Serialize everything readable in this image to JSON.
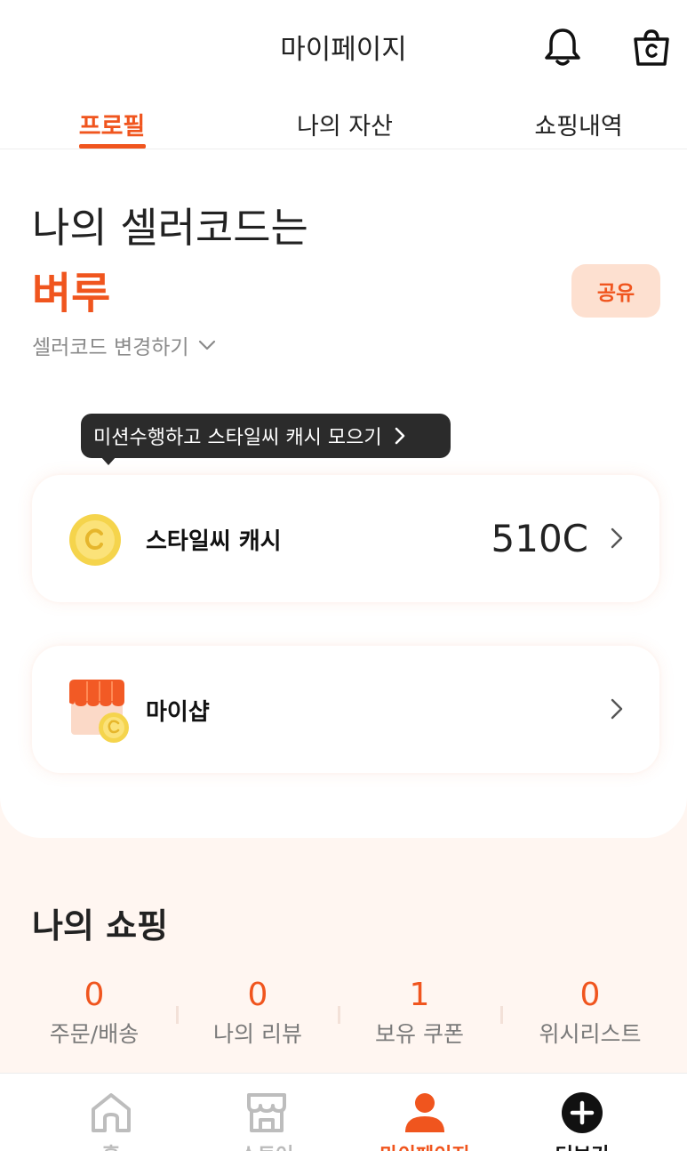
{
  "header": {
    "title": "마이페이지",
    "bell_icon": "bell-icon",
    "cart_icon": "shopping-bag-icon"
  },
  "tabs": [
    {
      "label": "프로필",
      "active": true
    },
    {
      "label": "나의 자산",
      "active": false
    },
    {
      "label": "쇼핑내역",
      "active": false
    }
  ],
  "profile": {
    "heading": "나의 셀러코드는",
    "seller_code": "벼루",
    "share_label": "공유",
    "change_code_label": "셀러코드 변경하기"
  },
  "tooltip": {
    "text": "미션수행하고 스타일씨 캐시 모으기"
  },
  "cash_card": {
    "label": "스타일씨 캐시",
    "value": "510C"
  },
  "shop_card": {
    "label": "마이샵"
  },
  "my_shopping": {
    "title": "나의 쇼핑",
    "stats": [
      {
        "value": "0",
        "label": "주문/배송"
      },
      {
        "value": "0",
        "label": "나의 리뷰"
      },
      {
        "value": "1",
        "label": "보유 쿠폰"
      },
      {
        "value": "0",
        "label": "위시리스트"
      }
    ]
  },
  "bottom_nav": [
    {
      "label": "홈",
      "icon": "home-icon"
    },
    {
      "label": "스토어",
      "icon": "store-icon"
    },
    {
      "label": "마이페이지",
      "icon": "person-icon",
      "active": true
    },
    {
      "label": "더보기",
      "icon": "plus-circle-icon"
    }
  ],
  "colors": {
    "accent": "#f0551e",
    "accent_light": "#fde0d0",
    "background": "#fff6f1",
    "tooltip_bg": "#2b2b2b"
  }
}
